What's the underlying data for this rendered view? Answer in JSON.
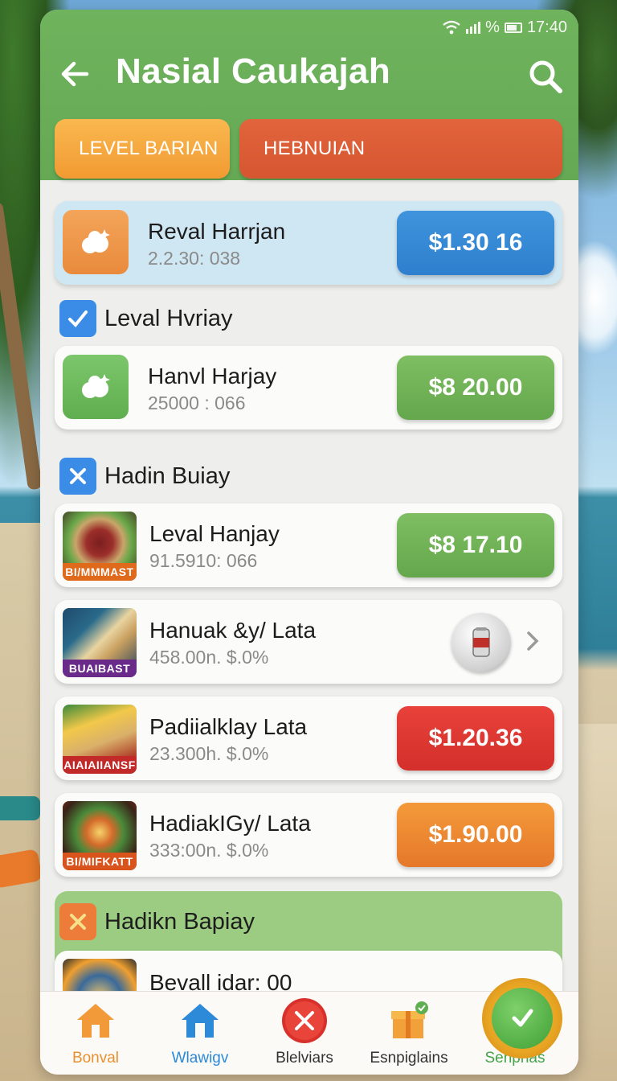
{
  "status": {
    "time": "17:40"
  },
  "header": {
    "title": "Nasial Caukajah",
    "back_icon": "arrow-left-icon",
    "search_icon": "search-icon"
  },
  "tabs": [
    {
      "label": "LEVEL BARIAN",
      "color": "#f29a32"
    },
    {
      "label": "HEBNUIAN",
      "color": "#d55630"
    }
  ],
  "top_card": {
    "title": "Reval Harrjan",
    "sub": "2.2.30: 038",
    "price": "$1.30 16"
  },
  "sections": [
    {
      "label": "Leval Hvriay",
      "icon": "check-icon"
    },
    {
      "label": "Hadin Buiay",
      "icon": "close-icon"
    },
    {
      "label": "Hadikn Bapiay",
      "icon": "close-icon"
    }
  ],
  "items": [
    {
      "title": "Hanvl Harjay",
      "sub": "25000 : 066",
      "price": "$8 20.00"
    },
    {
      "title": "Leval Hanjay",
      "sub": "91.5910: 066",
      "price": "$8 17.10",
      "thumb_label": "BI/MMMAST"
    },
    {
      "title": "Hanuak &y/ Lata",
      "sub": "458.00n. $.0%",
      "thumb_label": "BUAIBAST"
    },
    {
      "title": "Padiialklay Lata",
      "sub": "23.300h. $.0%",
      "price": "$1.20.36",
      "thumb_label": "AIAIAIIANSF"
    },
    {
      "title": "HadiakIGy/ Lata",
      "sub": "333:00n. $.0%",
      "price": "$1.90.00",
      "thumb_label": "BI/MIFKATT"
    },
    {
      "title": "Bevall idar: 00"
    }
  ],
  "nav": [
    {
      "label": "Bonval"
    },
    {
      "label": "Wlawigv"
    },
    {
      "label": "Blelviars"
    },
    {
      "label": "Esnpiglains"
    },
    {
      "label": "Senpnas"
    }
  ]
}
